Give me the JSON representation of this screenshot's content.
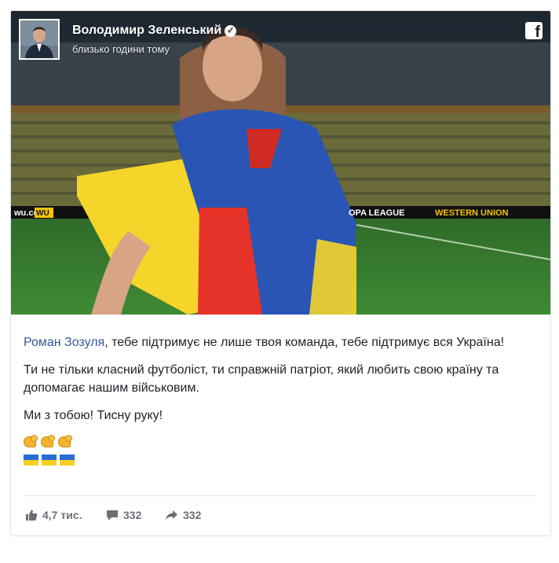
{
  "post": {
    "author": "Володимир Зеленський",
    "timestamp": "близько години тому",
    "verified_icon": "check-circle-icon",
    "brand_icon": "facebook-icon"
  },
  "image": {
    "banner_left": "wu.co",
    "banner_right": "OPA LEAGUE",
    "banner_right_brand": "WESTERN UNION",
    "banner_wu": "WU"
  },
  "body": {
    "mention": "Роман Зозуля",
    "line1_rest": ", тебе підтримує не лише твоя команда, тебе підтримує вся Україна!",
    "line2": "Ти не тільки класний футболіст, ти справжній патріот, який любить свою країну та допомагає нашим військовим.",
    "line3": "Ми з тобою! Тисну руку!"
  },
  "actions": {
    "likes": "4,7 тис.",
    "comments": "332",
    "shares": "332"
  },
  "colors": {
    "link": "#365899",
    "meta": "#6b6f76",
    "flag_blue": "#2a6cd5",
    "flag_yellow": "#f6d11e"
  }
}
